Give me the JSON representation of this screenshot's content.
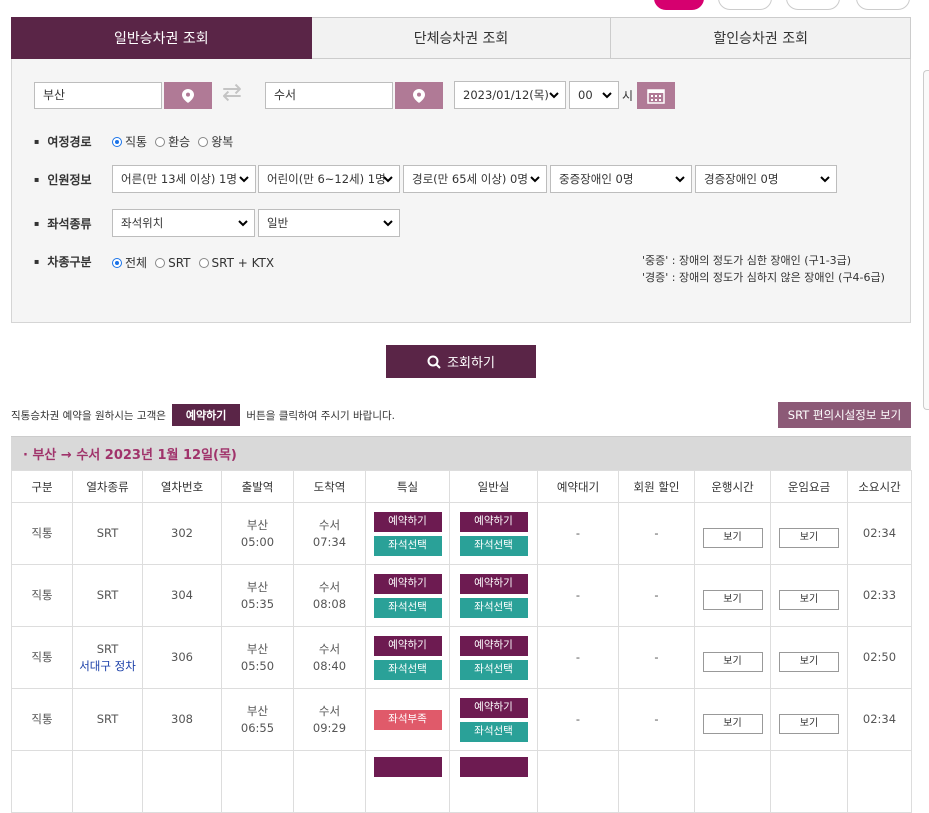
{
  "tabs": [
    "일반승차권 조회",
    "단체승차권 조회",
    "할인승차권 조회"
  ],
  "search": {
    "departure": "부산",
    "arrival": "수서",
    "date": "2023/01/12(목)",
    "hour": "00",
    "hour_unit": "시"
  },
  "route_type": {
    "label": "여정경로",
    "options": [
      "직통",
      "환승",
      "왕복"
    ],
    "selected": 0
  },
  "passengers": {
    "label": "인원정보",
    "adult": "어른(만 13세 이상) 1명",
    "child": "어린이(만 6~12세) 1명",
    "senior": "경로(만 65세 이상) 0명",
    "severe": "중증장애인 0명",
    "mild": "경증장애인 0명"
  },
  "seat_type": {
    "label": "좌석종류",
    "position": "좌석위치",
    "class": "일반"
  },
  "train_type": {
    "label": "차종구분",
    "options": [
      "전체",
      "SRT",
      "SRT + KTX"
    ],
    "selected": 0
  },
  "notes": [
    "'중증' : 장애의 정도가 심한 장애인 (구1-3급)",
    "'경증' : 장애의 정도가 심하지 않은 장애인 (구4-6급)"
  ],
  "search_button": "조회하기",
  "notice": {
    "before": "직통승차권 예약을 원하시는 고객은",
    "button": "예약하기",
    "after": "버튼을 클릭하여 주시기 바랍니다."
  },
  "facility_button": "SRT 편의시설정보 보기",
  "route_header": "· 부산 → 수서   2023년 1월 12일(목)",
  "columns": [
    "구분",
    "열차종류",
    "열차번호",
    "출발역",
    "도착역",
    "특실",
    "일반실",
    "예약대기",
    "회원 할인",
    "운행시간",
    "운임요금",
    "소요시간"
  ],
  "button_labels": {
    "reserve": "예약하기",
    "seat": "좌석선택",
    "sold_out": "좌석부족",
    "view": "보기"
  },
  "rows": [
    {
      "kind": "직통",
      "train": "SRT",
      "stop_note": "",
      "no": "302",
      "dep_st": "부산",
      "dep_t": "05:00",
      "arr_st": "수서",
      "arr_t": "07:34",
      "special": "available",
      "general": "available",
      "wait": "-",
      "member": "-",
      "duration": "02:34"
    },
    {
      "kind": "직통",
      "train": "SRT",
      "stop_note": "",
      "no": "304",
      "dep_st": "부산",
      "dep_t": "05:35",
      "arr_st": "수서",
      "arr_t": "08:08",
      "special": "available",
      "general": "available",
      "wait": "-",
      "member": "-",
      "duration": "02:33"
    },
    {
      "kind": "직통",
      "train": "SRT",
      "stop_note": "서대구 정차",
      "no": "306",
      "dep_st": "부산",
      "dep_t": "05:50",
      "arr_st": "수서",
      "arr_t": "08:40",
      "special": "available",
      "general": "available",
      "wait": "-",
      "member": "-",
      "duration": "02:50"
    },
    {
      "kind": "직통",
      "train": "SRT",
      "stop_note": "",
      "no": "308",
      "dep_st": "부산",
      "dep_t": "06:55",
      "arr_st": "수서",
      "arr_t": "09:29",
      "special": "soldout",
      "general": "available",
      "wait": "-",
      "member": "-",
      "duration": "02:34"
    }
  ],
  "colors": {
    "primary": "#5a2547",
    "reserve": "#6d1b51",
    "seat": "#2aa198",
    "soldout": "#e05a6a",
    "route_text": "#a0336b"
  }
}
